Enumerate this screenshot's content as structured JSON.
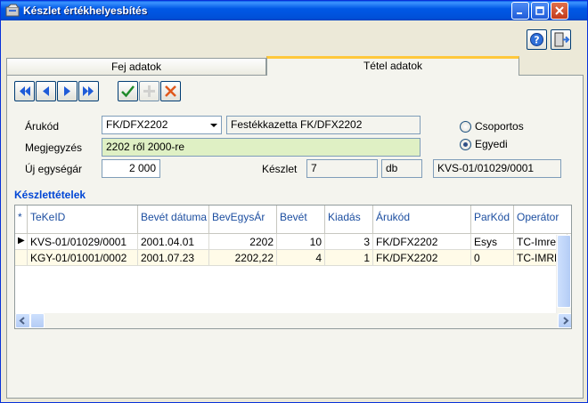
{
  "window": {
    "title": "Készlet értékhelyesbítés"
  },
  "tabs": [
    {
      "label": "Fej adatok"
    },
    {
      "label": "Tétel adatok"
    }
  ],
  "form": {
    "arukod_label": "Árukód",
    "arukod_value": "FK/DFX2202",
    "arukod_name": "Festékkazetta FK/DFX2202",
    "megjegyzes_label": "Megjegyzés",
    "megjegyzes_value": "2202 ről 2000-re",
    "uj_egysegar_label": "Új egységár",
    "uj_egysegar_value": "2 000",
    "keszlet_label": "Készlet",
    "keszlet_value": "7",
    "keszlet_unit": "db",
    "kvs_value": "KVS-01/01029/0001",
    "radio_csoportos": "Csoportos",
    "radio_egyedi": "Egyedi"
  },
  "grid": {
    "title": "Készlettételek",
    "columns": [
      "*",
      "TeKeID",
      "Bevét dátuma",
      "BevEgysÁr",
      "Bevét",
      "Kiadás",
      "Árukód",
      "ParKód",
      "Operátor"
    ],
    "rows": [
      {
        "marker": "▶",
        "cells": [
          "KVS-01/01029/0001",
          "2001.04.01",
          "2202",
          "10",
          "3",
          "FK/DFX2202",
          "Esys",
          "TC-Imre"
        ]
      },
      {
        "marker": "",
        "cells": [
          "KGY-01/01001/0002",
          "2001.07.23",
          "2202,22",
          "4",
          "1",
          "FK/DFX2202",
          "0",
          "TC-IMRE"
        ]
      }
    ]
  },
  "colors": {
    "accent": "#0046d5",
    "highlight_field": "#dff0c4",
    "row_alt": "#fffbe8"
  }
}
